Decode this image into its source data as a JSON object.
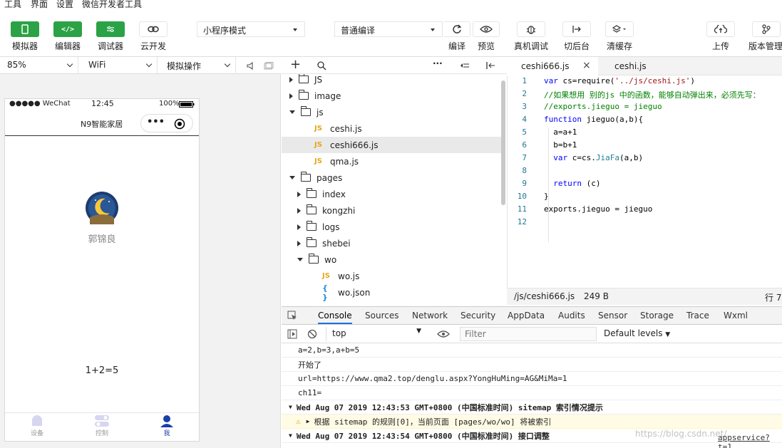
{
  "menu": [
    "工具",
    "界面",
    "设置",
    "微信开发者工具"
  ],
  "toolbar": {
    "simulator": "模拟器",
    "editor": "编辑器",
    "debugger": "调试器",
    "cloud": "云开发",
    "mode_select": "小程序模式",
    "compile_select": "普通编译",
    "compile": "编译",
    "preview": "预览",
    "remote_debug": "真机调试",
    "background": "切后台",
    "clear_cache": "清缓存",
    "upload": "上传",
    "version": "版本管理"
  },
  "simbar": {
    "zoom": "85%",
    "network": "WiFi",
    "operation": "模拟操作"
  },
  "phone": {
    "carrier": "●●●●● WeChat",
    "time": "12:45",
    "battery": "100%",
    "title": "N9智能家居",
    "username": "郭锦良",
    "result": "1+2=5",
    "tabs": [
      "设备",
      "控制",
      "我"
    ]
  },
  "tree": [
    {
      "label": "JS",
      "type": "folder",
      "level": 0,
      "open": false
    },
    {
      "label": "image",
      "type": "folder",
      "level": 0,
      "open": false
    },
    {
      "label": "js",
      "type": "folder",
      "level": 0,
      "open": true
    },
    {
      "label": "ceshi.js",
      "type": "js",
      "level": 1
    },
    {
      "label": "ceshi666.js",
      "type": "js",
      "level": 1,
      "selected": true
    },
    {
      "label": "qma.js",
      "type": "js",
      "level": 1
    },
    {
      "label": "pages",
      "type": "folder",
      "level": 0,
      "open": true
    },
    {
      "label": "index",
      "type": "folder",
      "level": 1,
      "open": false
    },
    {
      "label": "kongzhi",
      "type": "folder",
      "level": 1,
      "open": false
    },
    {
      "label": "logs",
      "type": "folder",
      "level": 1,
      "open": false
    },
    {
      "label": "shebei",
      "type": "folder",
      "level": 1,
      "open": false
    },
    {
      "label": "wo",
      "type": "folder",
      "level": 1,
      "open": true
    },
    {
      "label": "wo.js",
      "type": "js",
      "level": 2
    },
    {
      "label": "wo.json",
      "type": "json",
      "level": 2
    }
  ],
  "editor": {
    "tabs": [
      "ceshi666.js",
      "ceshi.js"
    ],
    "lines": [
      {
        "n": "1",
        "html": "<span class=\"kw\">var</span> cs=require(<span class=\"str\">'../js/ceshi.js'</span>)"
      },
      {
        "n": "2",
        "html": "<span class=\"cm\">//如果想用 别的js 中的函数，能够自动弹出来，必须先写：</span>"
      },
      {
        "n": "3",
        "html": "<span class=\"cm\">//exports.jieguo = jieguo</span>"
      },
      {
        "n": "4",
        "html": "<span class=\"kw\">function</span> jieguo(a,b){"
      },
      {
        "n": "5",
        "html": "  a=a+<span class=\"num\">1</span>"
      },
      {
        "n": "6",
        "html": "  b=b+<span class=\"num\">1</span>"
      },
      {
        "n": "7",
        "html": "  <span class=\"kw\">var</span> c=cs.<span class=\"fn\">JiaFa</span>(a,b)"
      },
      {
        "n": "8",
        "html": ""
      },
      {
        "n": "9",
        "html": "  <span class=\"kw\">return</span> (c)"
      },
      {
        "n": "10",
        "html": "}"
      },
      {
        "n": "11",
        "html": "exports.jieguo = jieguo"
      },
      {
        "n": "12",
        "html": ""
      }
    ],
    "status_path": "/js/ceshi666.js",
    "status_size": "249 B",
    "status_line": "行 7"
  },
  "devtools": {
    "tabs": [
      "Console",
      "Sources",
      "Network",
      "Security",
      "AppData",
      "Audits",
      "Sensor",
      "Storage",
      "Trace",
      "Wxml"
    ],
    "context": "top",
    "filter_placeholder": "Filter",
    "levels": "Default levels"
  },
  "console": [
    {
      "text": "a=2,b=3,a+b=5",
      "kind": "log"
    },
    {
      "text": "开始了",
      "kind": "log"
    },
    {
      "text": "url=https://www.qma2.top/denglu.aspx?YongHuMing=AG&MiMa=1",
      "kind": "log"
    },
    {
      "text": "ch11=",
      "kind": "log"
    },
    {
      "text": "Wed Aug 07 2019 12:43:53 GMT+0800 (中国标准时间) sitemap 索引情况提示",
      "kind": "group"
    },
    {
      "text": "根据 sitemap 的规则[0]，当前页面 [pages/wo/wo] 将被索引",
      "kind": "warn"
    },
    {
      "text": "Wed Aug 07 2019 12:43:54 GMT+0800 (中国标准时间) 接口调整",
      "kind": "group"
    }
  ],
  "console_source": "appservice?t=1",
  "watermark": "https://blog.csdn.net/..."
}
